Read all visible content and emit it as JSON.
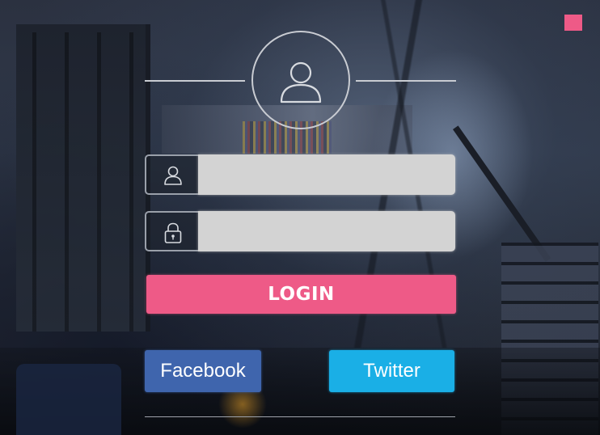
{
  "window": {
    "close_icon": "close-square-icon",
    "accent_color": "#ee5a87"
  },
  "header": {
    "avatar_icon": "user-avatar-icon"
  },
  "form": {
    "username": {
      "icon": "user-icon",
      "value": "",
      "placeholder": ""
    },
    "password": {
      "icon": "lock-icon",
      "value": "",
      "placeholder": ""
    },
    "login_label": "LOGIN",
    "login_color": "#ee5a87"
  },
  "social": {
    "facebook_label": "Facebook",
    "facebook_color": "#3f65ad",
    "twitter_label": "Twitter",
    "twitter_color": "#1aafe6"
  }
}
